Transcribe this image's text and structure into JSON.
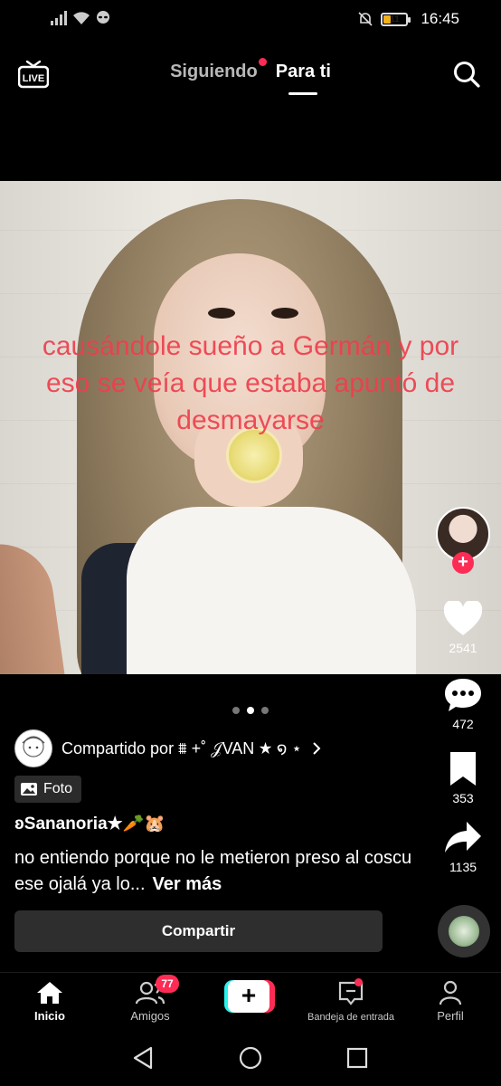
{
  "status_bar": {
    "time": "16:45",
    "battery": "11"
  },
  "top_nav": {
    "live_label": "LIVE",
    "tabs": [
      {
        "label": "Siguiendo"
      },
      {
        "label": "Para ti"
      }
    ]
  },
  "post": {
    "overlay_text": "causándole sueño a Germán y por eso se veía que estaba apuntó de desmayarse",
    "shared_by": "Compartido por ⩩ +˚ 𝒥VAN ★ ໑ ⋆",
    "type_badge": "Foto",
    "author": "ʚSananoria★🥕🐹",
    "caption": "no entiendo porque no le metieron preso al coscu ese ojalá ya lo...",
    "see_more": "Ver más",
    "share_button": "Compartir"
  },
  "rail": {
    "likes": "2541",
    "comments": "472",
    "saves": "353",
    "shares": "1135"
  },
  "bottom_nav": {
    "home": "Inicio",
    "friends": "Amigos",
    "friends_badge": "77",
    "create": "+",
    "inbox": "Bandeja de entrada",
    "profile": "Perfil"
  },
  "colors": {
    "accent": "#fe2c55",
    "overlay_text": "#ee3f4d",
    "cyan": "#25f4ee"
  }
}
